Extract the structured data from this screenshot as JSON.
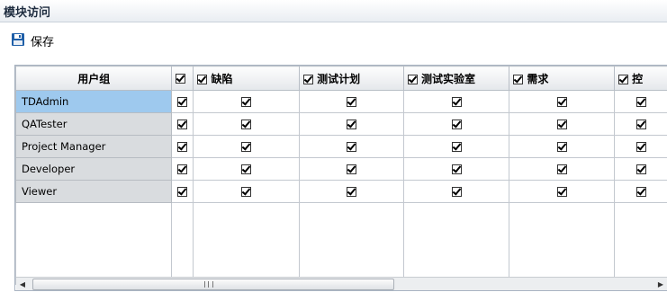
{
  "panel": {
    "title": "模块访问"
  },
  "toolbar": {
    "save_label": "保存",
    "save_icon": "floppy-disk-icon"
  },
  "grid": {
    "columns": [
      {
        "label": "用户组",
        "has_checkbox": false
      },
      {
        "label": "",
        "has_checkbox": true
      },
      {
        "label": "缺陷",
        "has_checkbox": true
      },
      {
        "label": "测试计划",
        "has_checkbox": true
      },
      {
        "label": "测试实验室",
        "has_checkbox": true
      },
      {
        "label": "需求",
        "has_checkbox": true
      },
      {
        "label": "控",
        "has_checkbox": true
      }
    ],
    "rows": [
      {
        "name": "TDAdmin",
        "selected": true,
        "checks": [
          true,
          true,
          true,
          true,
          true,
          true
        ]
      },
      {
        "name": "QATester",
        "selected": false,
        "checks": [
          true,
          true,
          true,
          true,
          true,
          true
        ]
      },
      {
        "name": "Project Manager",
        "selected": false,
        "checks": [
          true,
          true,
          true,
          true,
          true,
          true
        ]
      },
      {
        "name": "Developer",
        "selected": false,
        "checks": [
          true,
          true,
          true,
          true,
          true,
          true
        ]
      },
      {
        "name": "Viewer",
        "selected": false,
        "checks": [
          true,
          true,
          true,
          true,
          true,
          true
        ]
      }
    ]
  },
  "colors": {
    "selected_row": "#9ec9ee",
    "group_cell": "#d9dcdf",
    "grid_border": "#c3c8cf"
  }
}
